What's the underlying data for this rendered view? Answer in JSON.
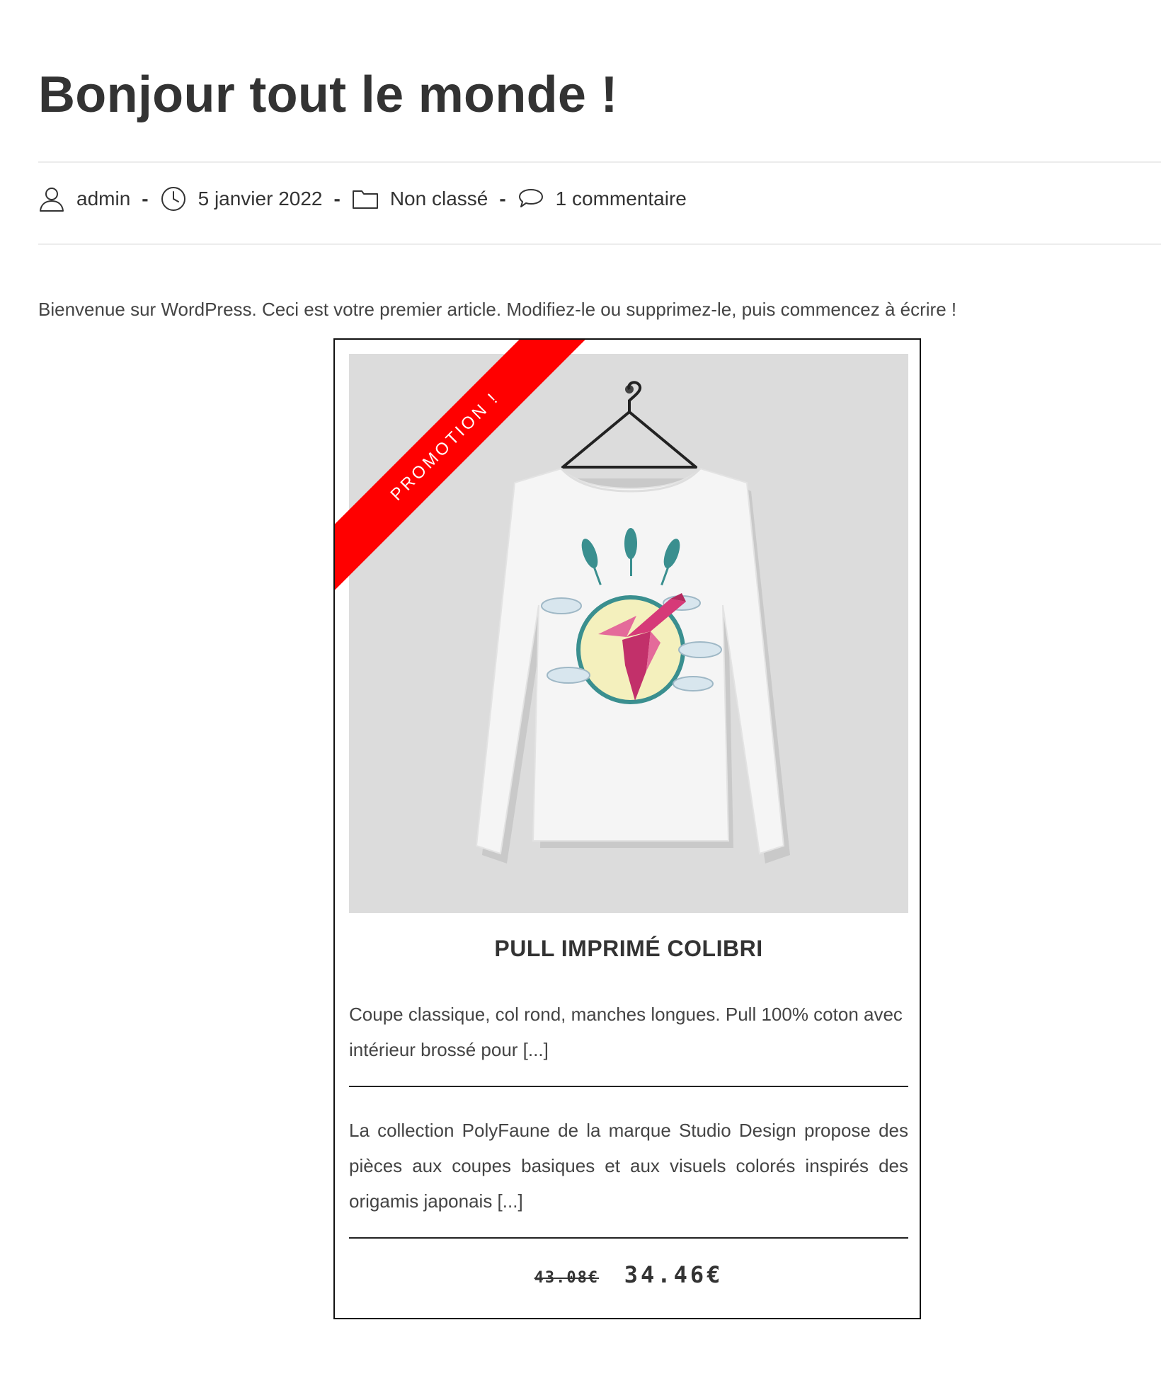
{
  "post": {
    "title": "Bonjour tout le monde !",
    "meta": {
      "author": "admin",
      "date": "5 janvier 2022",
      "category": "Non classé",
      "comments": "1 commentaire",
      "separator": "-",
      "icons": [
        "user-icon",
        "clock-icon",
        "folder-icon",
        "comment-icon"
      ]
    },
    "intro": "Bienvenue sur WordPress. Ceci est votre premier article. Modifiez-le ou supprimez-le, puis commencez à écrire !"
  },
  "product": {
    "ribbon": "PROMOTION !",
    "name": "PULL IMPRIMÉ COLIBRI",
    "short_description": "Coupe classique, col rond, manches longues. Pull 100% coton avec intérieur brossé pour [...]",
    "long_description": "La collection PolyFaune de la marque Studio Design propose des pièces aux coupes basiques et aux visuels colorés inspirés des origamis japonais [...]",
    "old_price": "43.08€",
    "new_price": "34.46€",
    "image_alt": "long sleeve white t-shirt with hummingbird print on hanger"
  },
  "colors": {
    "ribbon": "#ff0000",
    "text": "#333333",
    "image_bg": "#dcdcdc",
    "print_teal": "#3a8f8f",
    "print_pink": "#d63a78",
    "print_moon": "#f4f0bd"
  }
}
